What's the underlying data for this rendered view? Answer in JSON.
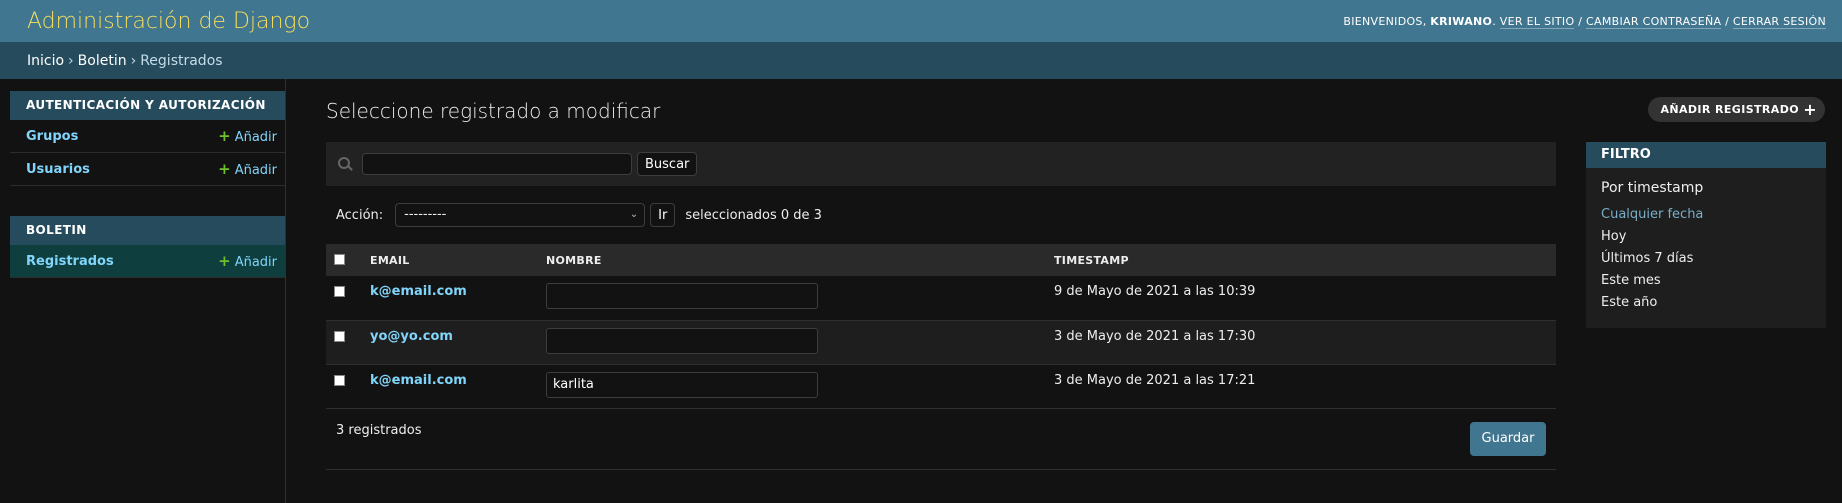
{
  "header": {
    "branding": "Administración de Django",
    "welcome": "Bienvenidos, ",
    "username": "Kriwano",
    "links": [
      "Ver el sitio",
      "Cambiar contraseña",
      "Cerrar sesión"
    ],
    "separator": " / "
  },
  "breadcrumbs": {
    "items": [
      "Inicio",
      "Boletin",
      "Registrados"
    ],
    "separator": "›"
  },
  "sidebar": {
    "modules": [
      {
        "caption": "Autenticación y autorización",
        "rows": [
          {
            "label": "Grupos",
            "add_label": "Añadir"
          },
          {
            "label": "Usuarios",
            "add_label": "Añadir"
          }
        ]
      },
      {
        "caption": "Boletin",
        "rows": [
          {
            "label": "Registrados",
            "add_label": "Añadir"
          }
        ]
      }
    ]
  },
  "content": {
    "title": "Seleccione registrado a modificar",
    "add_button": "Añadir registrado",
    "search": {
      "value": "",
      "button": "Buscar"
    },
    "actions": {
      "label": "Acción:",
      "selected_option": "---------",
      "go_button": "Ir",
      "counter": "seleccionados 0 de 3"
    },
    "table": {
      "headers": [
        "Email",
        "Nombre",
        "Timestamp"
      ],
      "rows": [
        {
          "email": "k@email.com",
          "nombre": "",
          "timestamp": "9 de Mayo de 2021 a las 10:39"
        },
        {
          "email": "yo@yo.com",
          "nombre": "",
          "timestamp": "3 de Mayo de 2021 a las 17:30"
        },
        {
          "email": "k@email.com",
          "nombre": "karlita",
          "timestamp": "3 de Mayo de 2021 a las 17:21"
        }
      ]
    },
    "result_count": "3 registrados",
    "save_button": "Guardar"
  },
  "filter": {
    "title": "Filtro",
    "subtitle": "Por timestamp",
    "options": [
      "Cualquier fecha",
      "Hoy",
      "Últimos 7 días",
      "Este mes",
      "Este año"
    ],
    "selected_index": 0
  },
  "colors": {
    "header_bg": "#417690",
    "branding": "#f5dd5d",
    "link": "#81d4fa",
    "add_plus": "#70bf2b",
    "caption_bg": "#264b5d"
  }
}
